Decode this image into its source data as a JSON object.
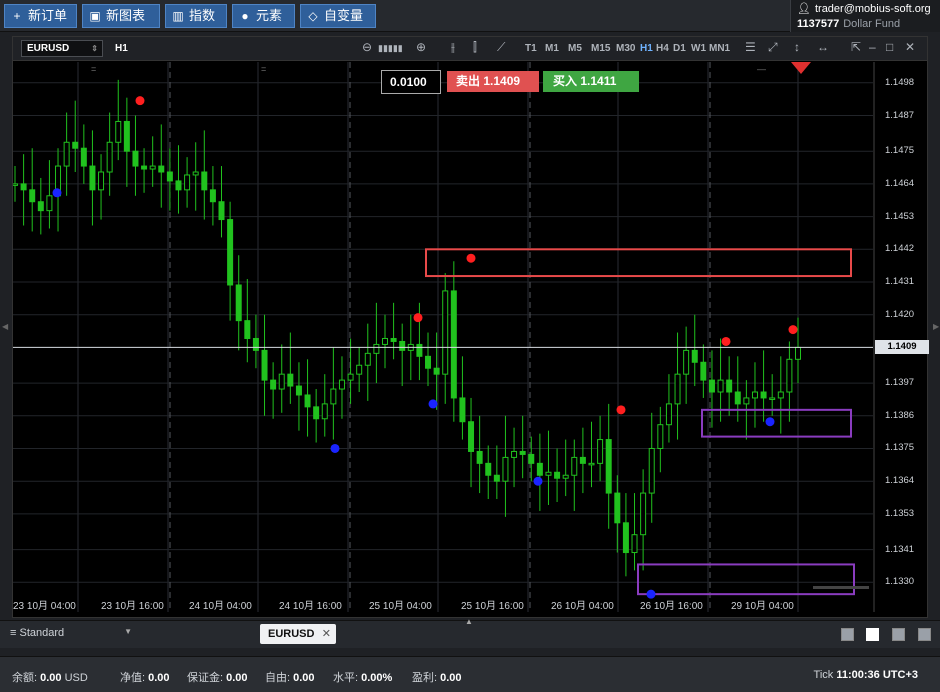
{
  "toolbar": {
    "buttons": [
      {
        "icon": "plus-icon",
        "glyph": "+",
        "label": "新订单"
      },
      {
        "icon": "chart-window-icon",
        "glyph": "▣",
        "label": "新图表"
      },
      {
        "icon": "indicator-icon",
        "glyph": "▥",
        "label": "指数"
      },
      {
        "icon": "elements-icon",
        "glyph": "●",
        "label": "元素"
      },
      {
        "icon": "diamond-icon",
        "glyph": "◇",
        "label": "自变量"
      }
    ]
  },
  "account": {
    "email": "trader@mobius-soft.org",
    "number": "1137577",
    "fund": "Dollar Fund"
  },
  "chart": {
    "symbol": "EURUSD",
    "timeframe": "H1",
    "timeframes": [
      "T1",
      "M1",
      "M5",
      "M15",
      "M30",
      "H1",
      "H4",
      "D1",
      "W1",
      "MN1"
    ],
    "selected_timeframe": "H1",
    "lot": "0.0100",
    "sell_label": "卖出",
    "sell_price": "1.1409",
    "buy_label": "买入",
    "buy_price": "1.1411",
    "current_price": "1.1409",
    "y_labels": [
      "1.1498",
      "1.1487",
      "1.1475",
      "1.1464",
      "1.1453",
      "1.1442",
      "1.1431",
      "1.1420",
      "1.1397",
      "1.1386",
      "1.1375",
      "1.1364",
      "1.1353",
      "1.1341",
      "1.1330"
    ],
    "x_labels": [
      "23 10月 04:00",
      "23 10月 16:00",
      "24 10月 04:00",
      "24 10月 16:00",
      "25 10月 04:00",
      "25 10月 16:00",
      "26 10月 04:00",
      "26 10月 16:00",
      "29 10月 04:00"
    ]
  },
  "chart_data": {
    "type": "candlestick",
    "title": "EURUSD H1",
    "ylim": [
      1.132,
      1.1505
    ],
    "current_price": 1.1409,
    "colors": {
      "bull": "#21c21e",
      "bear": "#21c21e",
      "background": "#000000",
      "up_signal": "#ff1f1f",
      "down_signal": "#1a24ff",
      "resistance_box": "#e84a4a",
      "support_box": "#8a3cbf"
    },
    "close_path": [
      1.1464,
      1.1462,
      1.1458,
      1.1455,
      1.146,
      1.147,
      1.1478,
      1.1476,
      1.147,
      1.1462,
      1.1468,
      1.1478,
      1.1485,
      1.1475,
      1.147,
      1.1469,
      1.147,
      1.1468,
      1.1465,
      1.1462,
      1.1467,
      1.1468,
      1.1462,
      1.1458,
      1.1452,
      1.143,
      1.1418,
      1.1412,
      1.1408,
      1.1398,
      1.1395,
      1.14,
      1.1396,
      1.1393,
      1.1389,
      1.1385,
      1.139,
      1.1395,
      1.1398,
      1.14,
      1.1403,
      1.1407,
      1.141,
      1.1412,
      1.1411,
      1.1408,
      1.141,
      1.1406,
      1.1402,
      1.14,
      1.1428,
      1.1392,
      1.1384,
      1.1374,
      1.137,
      1.1366,
      1.1364,
      1.1372,
      1.1374,
      1.1373,
      1.137,
      1.1366,
      1.1367,
      1.1365,
      1.1366,
      1.1372,
      1.137,
      1.137,
      1.1378,
      1.136,
      1.135,
      1.134,
      1.1346,
      1.136,
      1.1375,
      1.1383,
      1.139,
      1.14,
      1.1408,
      1.1404,
      1.1398,
      1.1394,
      1.1398,
      1.1394,
      1.139,
      1.1392,
      1.1394,
      1.1392,
      1.1392,
      1.1394,
      1.1405,
      1.1409
    ],
    "up_signals": [
      1.1492,
      1.1419,
      1.1439,
      1.1388,
      1.1411,
      1.1415
    ],
    "down_signals": [
      1.1461,
      1.1375,
      1.139,
      1.1364,
      1.1326,
      1.1384
    ],
    "zones": [
      {
        "kind": "resistance",
        "from": 1.1433,
        "to": 1.1442
      },
      {
        "kind": "support",
        "from": 1.1379,
        "to": 1.1388
      },
      {
        "kind": "support",
        "from": 1.1326,
        "to": 1.1336
      }
    ]
  },
  "bottom": {
    "profile": "Standard",
    "symbol_tab": "EURUSD"
  },
  "status": {
    "balance_label": "余额:",
    "balance": "0.00",
    "currency": "USD",
    "equity_label": "净值:",
    "equity": "0.00",
    "margin_label": "保证金:",
    "margin": "0.00",
    "free_label": "自由:",
    "free": "0.00",
    "level_label": "水平:",
    "level": "0.00%",
    "profit_label": "盈利:",
    "profit": "0.00",
    "tick_label": "Tick",
    "time": "11:00:36",
    "tz": "UTC+3"
  }
}
